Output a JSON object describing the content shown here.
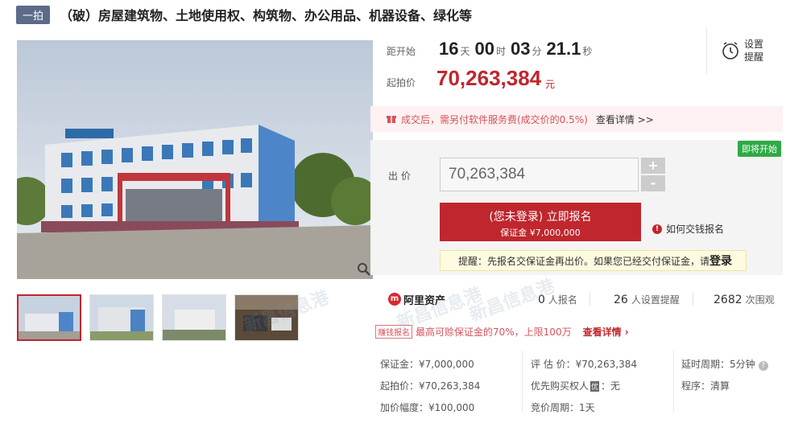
{
  "header": {
    "tag": "一拍",
    "title": "（破）房屋建筑物、土地使用权、构筑物、办公用品、机器设备、绿化等"
  },
  "countdown": {
    "label": "距开始",
    "days": "16",
    "days_unit": "天",
    "hours": "00",
    "hours_unit": "时",
    "minutes": "03",
    "minutes_unit": "分",
    "seconds": "21.1",
    "seconds_unit": "秒"
  },
  "remind": {
    "line1": "设置",
    "line2": "提醒"
  },
  "start_price": {
    "label": "起拍价",
    "value": "70,263,384",
    "unit": "元"
  },
  "fee_notice": {
    "text": "成交后，需另付软件服务费(成交价的0.5%)",
    "link": "查看详情 >>"
  },
  "bid": {
    "status_badge": "即将开始",
    "label": "出 价",
    "input_value": "70,263,384",
    "plus": "+",
    "minus": "-",
    "apply_main": "(您未登录) 立即报名",
    "apply_sub": "保证金 ¥7,000,000",
    "how_to": "如何交钱报名",
    "tip_text": "提醒：先报名交保证金再出价。如果您已经交付保证金，请",
    "tip_login": "登录"
  },
  "stats": {
    "brand": "阿里资产",
    "applicants_count": "0",
    "applicants_label": "人报名",
    "reminders_count": "26",
    "reminders_label": "人设置提醒",
    "views_count": "2682",
    "views_label": "次围观"
  },
  "promo": {
    "tag": "赚钱报名",
    "text": "最高可赊保证金的70%，上限100万",
    "link": "查看详情"
  },
  "details": {
    "deposit": "保证金：¥7,000,000",
    "start": "起拍价：¥70,263,384",
    "increment": "加价幅度：¥100,000",
    "appraisal": "评 估 价：¥70,263,384",
    "priority_prefix": "优先购买权人",
    "priority_box": "优",
    "priority_value": "：无",
    "bid_period": "竞价周期：1天",
    "delay": "延时周期：5分钟",
    "procedure": "程序：清算"
  },
  "watermark": "新昌信息港"
}
